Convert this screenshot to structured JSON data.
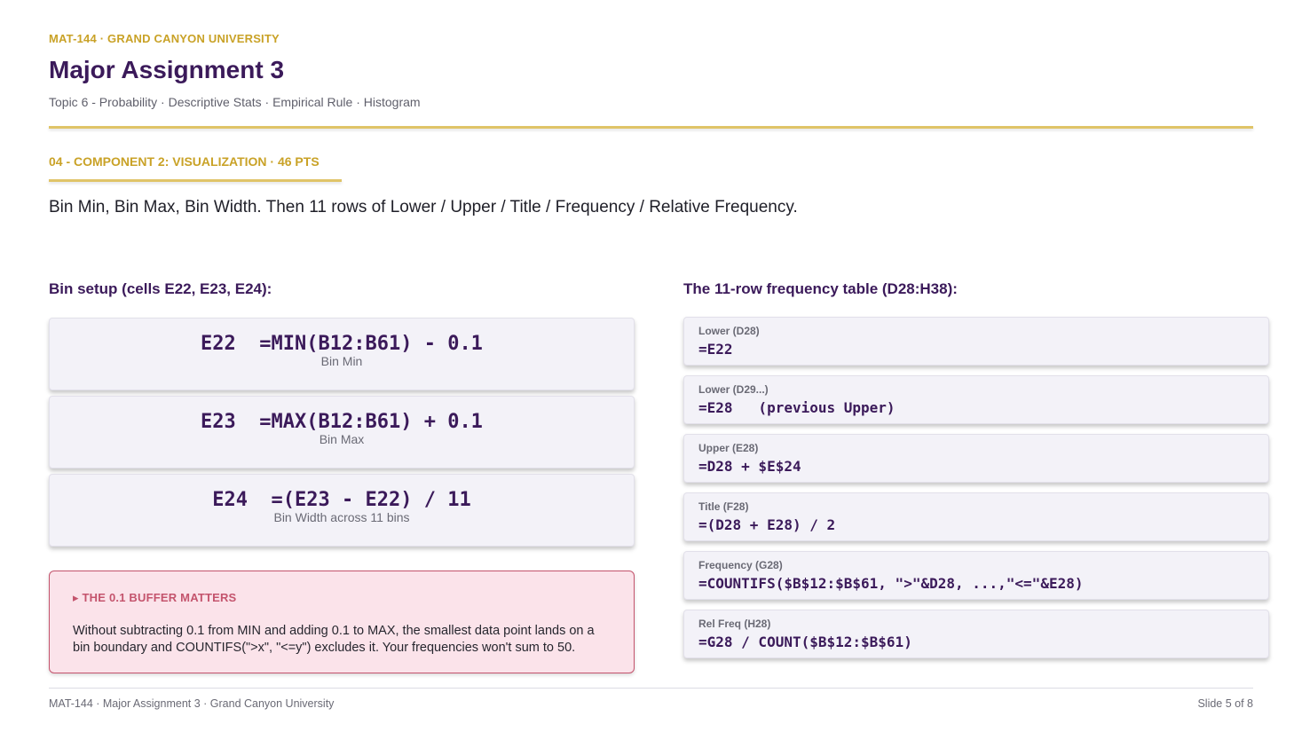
{
  "header": {
    "eyebrow": "MAT-144  ·  GRAND CANYON UNIVERSITY",
    "title": "Major Assignment 3",
    "subtitle": "Topic 6 - Probability · Descriptive Stats · Empirical Rule · Histogram"
  },
  "section": {
    "label": "04 - COMPONENT 2: VISUALIZATION · 46 PTS",
    "lead": "Bin Min, Bin Max, Bin Width. Then 11 rows of Lower / Upper / Title / Frequency / Relative Frequency."
  },
  "bin_setup": {
    "heading": "Bin setup (cells E22, E23, E24):",
    "cards": [
      {
        "formula": "E22  =MIN(B12:B61) - 0.1",
        "caption": "Bin Min"
      },
      {
        "formula": "E23  =MAX(B12:B61) + 0.1",
        "caption": "Bin Max"
      },
      {
        "formula": "E24  =(E23 - E22) / 11",
        "caption": "Bin Width across 11 bins"
      }
    ]
  },
  "callout": {
    "heading": "▸ THE 0.1 BUFFER MATTERS",
    "body": "Without subtracting 0.1 from MIN and adding 0.1 to MAX, the smallest data point lands on a bin boundary and COUNTIFS(\">x\", \"<=y\") excludes it. Your frequencies won't sum to 50."
  },
  "frequency_table": {
    "heading": "The 11-row frequency table (D28:H38):",
    "rows": [
      {
        "label": "Lower (D28)",
        "formula": "=E22"
      },
      {
        "label": "Lower (D29...)",
        "formula": "=E28   (previous Upper)"
      },
      {
        "label": "Upper (E28)",
        "formula": "=D28 + $E$24"
      },
      {
        "label": "Title (F28)",
        "formula": "=(D28 + E28) / 2"
      },
      {
        "label": "Frequency (G28)",
        "formula": "=COUNTIFS($B$12:$B$61, \">\"&D28, ...,\"<=\"&E28)"
      },
      {
        "label": "Rel Freq (H28)",
        "formula": "=G28 / COUNT($B$12:$B$61)"
      }
    ]
  },
  "footer": {
    "left": "MAT-144 · Major Assignment 3 · Grand Canyon University",
    "right": "Slide 5 of 8"
  },
  "colors": {
    "accent_gold": "#c9a227",
    "brand_purple": "#3b1a5a",
    "callout_red": "#c4546d"
  }
}
